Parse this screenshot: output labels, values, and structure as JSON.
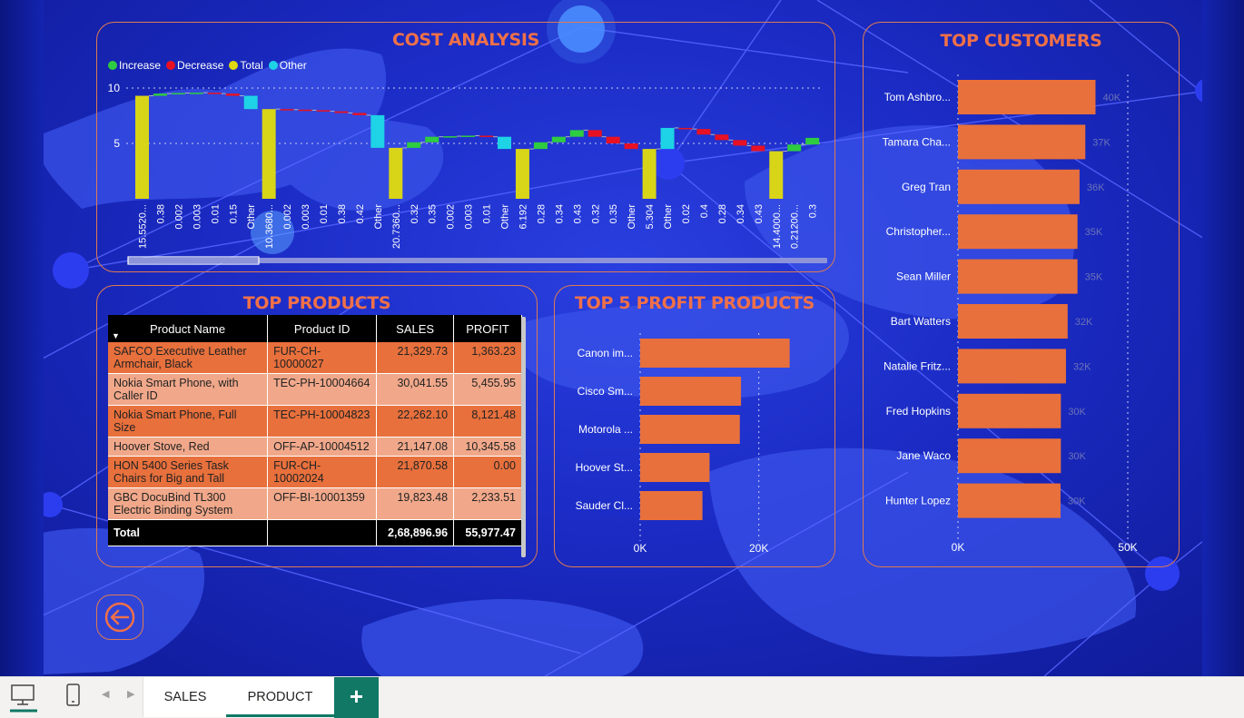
{
  "cost_analysis": {
    "title": "COST ANALYSIS",
    "legend": [
      {
        "label": "Increase",
        "color": "#2ecc40"
      },
      {
        "label": "Decrease",
        "color": "#e81123"
      },
      {
        "label": "Total",
        "color": "#e0d810"
      },
      {
        "label": "Other",
        "color": "#1ed3e6"
      }
    ],
    "y_ticks": [
      "10",
      "5"
    ],
    "chart_data": {
      "type": "waterfall",
      "title": "COST ANALYSIS",
      "ylim": [
        0,
        10
      ],
      "categories": [
        "15.5520...",
        "0.38",
        "0.002",
        "0.003",
        "0.01",
        "0.15",
        "Other",
        "10.3680...",
        "0.002",
        "0.003",
        "0.01",
        "0.38",
        "0.42",
        "Other",
        "20.7360...",
        "0.32",
        "0.35",
        "0.002",
        "0.003",
        "0.01",
        "Other",
        "6.192",
        "0.28",
        "0.34",
        "0.43",
        "0.32",
        "0.35",
        "Other",
        "5.304",
        "Other",
        "0.02",
        "0.4",
        "0.28",
        "0.34",
        "0.43",
        "14.4000...",
        "0.21200...",
        "0.3"
      ],
      "bars": [
        {
          "type": "total",
          "low": 0,
          "high": 9.3
        },
        {
          "type": "increase",
          "low": 9.3,
          "high": 9.5
        },
        {
          "type": "increase",
          "low": 9.5,
          "high": 9.55
        },
        {
          "type": "increase",
          "low": 9.55,
          "high": 9.58
        },
        {
          "type": "decrease",
          "low": 9.5,
          "high": 9.58
        },
        {
          "type": "decrease",
          "low": 9.3,
          "high": 9.5
        },
        {
          "type": "other",
          "low": 8.1,
          "high": 9.3
        },
        {
          "type": "total",
          "low": 0,
          "high": 8.1
        },
        {
          "type": "decrease",
          "low": 8.05,
          "high": 8.1
        },
        {
          "type": "decrease",
          "low": 8.0,
          "high": 8.05
        },
        {
          "type": "decrease",
          "low": 7.9,
          "high": 8.0
        },
        {
          "type": "decrease",
          "low": 7.75,
          "high": 7.9
        },
        {
          "type": "decrease",
          "low": 7.55,
          "high": 7.75
        },
        {
          "type": "other",
          "low": 4.6,
          "high": 7.55
        },
        {
          "type": "total",
          "low": 0,
          "high": 4.6
        },
        {
          "type": "increase",
          "low": 4.6,
          "high": 5.1
        },
        {
          "type": "increase",
          "low": 5.1,
          "high": 5.6
        },
        {
          "type": "increase",
          "low": 5.6,
          "high": 5.65
        },
        {
          "type": "increase",
          "low": 5.65,
          "high": 5.7
        },
        {
          "type": "decrease",
          "low": 5.6,
          "high": 5.7
        },
        {
          "type": "other",
          "low": 4.5,
          "high": 5.6
        },
        {
          "type": "total",
          "low": 0,
          "high": 4.5
        },
        {
          "type": "increase",
          "low": 4.5,
          "high": 5.1
        },
        {
          "type": "increase",
          "low": 5.1,
          "high": 5.6
        },
        {
          "type": "increase",
          "low": 5.6,
          "high": 6.2
        },
        {
          "type": "decrease",
          "low": 5.6,
          "high": 6.2
        },
        {
          "type": "decrease",
          "low": 5.0,
          "high": 5.6
        },
        {
          "type": "decrease",
          "low": 4.5,
          "high": 5.0
        },
        {
          "type": "total",
          "low": 0,
          "high": 4.5
        },
        {
          "type": "other",
          "low": 4.5,
          "high": 6.4
        },
        {
          "type": "decrease",
          "low": 6.3,
          "high": 6.4
        },
        {
          "type": "decrease",
          "low": 5.8,
          "high": 6.3
        },
        {
          "type": "decrease",
          "low": 5.3,
          "high": 5.8
        },
        {
          "type": "decrease",
          "low": 4.8,
          "high": 5.3
        },
        {
          "type": "decrease",
          "low": 4.3,
          "high": 4.8
        },
        {
          "type": "total",
          "low": 0,
          "high": 4.3
        },
        {
          "type": "increase",
          "low": 4.3,
          "high": 4.9
        },
        {
          "type": "increase",
          "low": 4.9,
          "high": 5.5
        }
      ]
    }
  },
  "top_products": {
    "title": "TOP PRODUCTS",
    "columns": [
      "Product Name",
      "Product ID",
      "SALES",
      "PROFIT"
    ],
    "rows": [
      {
        "name": "SAFCO Executive Leather Armchair, Black",
        "id": "FUR-CH-10000027",
        "sales": "21,329.73",
        "profit": "1,363.23"
      },
      {
        "name": "Nokia Smart Phone, with Caller ID",
        "id": "TEC-PH-10004664",
        "sales": "30,041.55",
        "profit": "5,455.95"
      },
      {
        "name": "Nokia Smart Phone, Full Size",
        "id": "TEC-PH-10004823",
        "sales": "22,262.10",
        "profit": "8,121.48"
      },
      {
        "name": "Hoover Stove, Red",
        "id": "OFF-AP-10004512",
        "sales": "21,147.08",
        "profit": "10,345.58"
      },
      {
        "name": "HON 5400 Series Task Chairs for Big and Tall",
        "id": "FUR-CH-10002024",
        "sales": "21,870.58",
        "profit": "0.00"
      },
      {
        "name": "GBC DocuBind TL300 Electric Binding System",
        "id": "OFF-BI-10001359",
        "sales": "19,823.48",
        "profit": "2,233.51"
      }
    ],
    "total": {
      "label": "Total",
      "sales": "2,68,896.96",
      "profit": "55,977.47"
    }
  },
  "top5_profit": {
    "title": "TOP 5 PROFIT PRODUCTS",
    "chart_data": {
      "type": "bar",
      "orientation": "horizontal",
      "title": "TOP 5 PROFIT PRODUCTS",
      "categories": [
        "Canon im...",
        "Cisco Sm...",
        "Motorola ...",
        "Hoover St...",
        "Sauder Cl..."
      ],
      "values": [
        25200,
        17000,
        16800,
        11700,
        10500
      ],
      "xlim": [
        0,
        30000
      ],
      "x_ticks": [
        "0K",
        "20K"
      ],
      "x_tick_values": [
        0,
        20000
      ]
    }
  },
  "top_customers": {
    "title": "TOP CUSTOMERS",
    "chart_data": {
      "type": "bar",
      "orientation": "horizontal",
      "title": "TOP CUSTOMERS",
      "categories": [
        "Tom Ashbro...",
        "Tamara Cha...",
        "Greg Tran",
        "Christopher...",
        "Sean Miller",
        "Bart Watters",
        "Natalie Fritz...",
        "Fred Hopkins",
        "Jane Waco",
        "Hunter Lopez"
      ],
      "values": [
        40500,
        37500,
        35800,
        35200,
        35200,
        32300,
        31800,
        30300,
        30300,
        30200
      ],
      "data_labels": [
        "40K",
        "37K",
        "36K",
        "35K",
        "35K",
        "32K",
        "32K",
        "30K",
        "30K",
        "30K"
      ],
      "xlim": [
        0,
        50000
      ],
      "x_ticks": [
        "0K",
        "50K"
      ],
      "x_tick_values": [
        0,
        50000
      ]
    }
  },
  "tabs": [
    {
      "label": "SALES",
      "active": false
    },
    {
      "label": "PRODUCT",
      "active": true
    }
  ],
  "add_tab_label": "+"
}
